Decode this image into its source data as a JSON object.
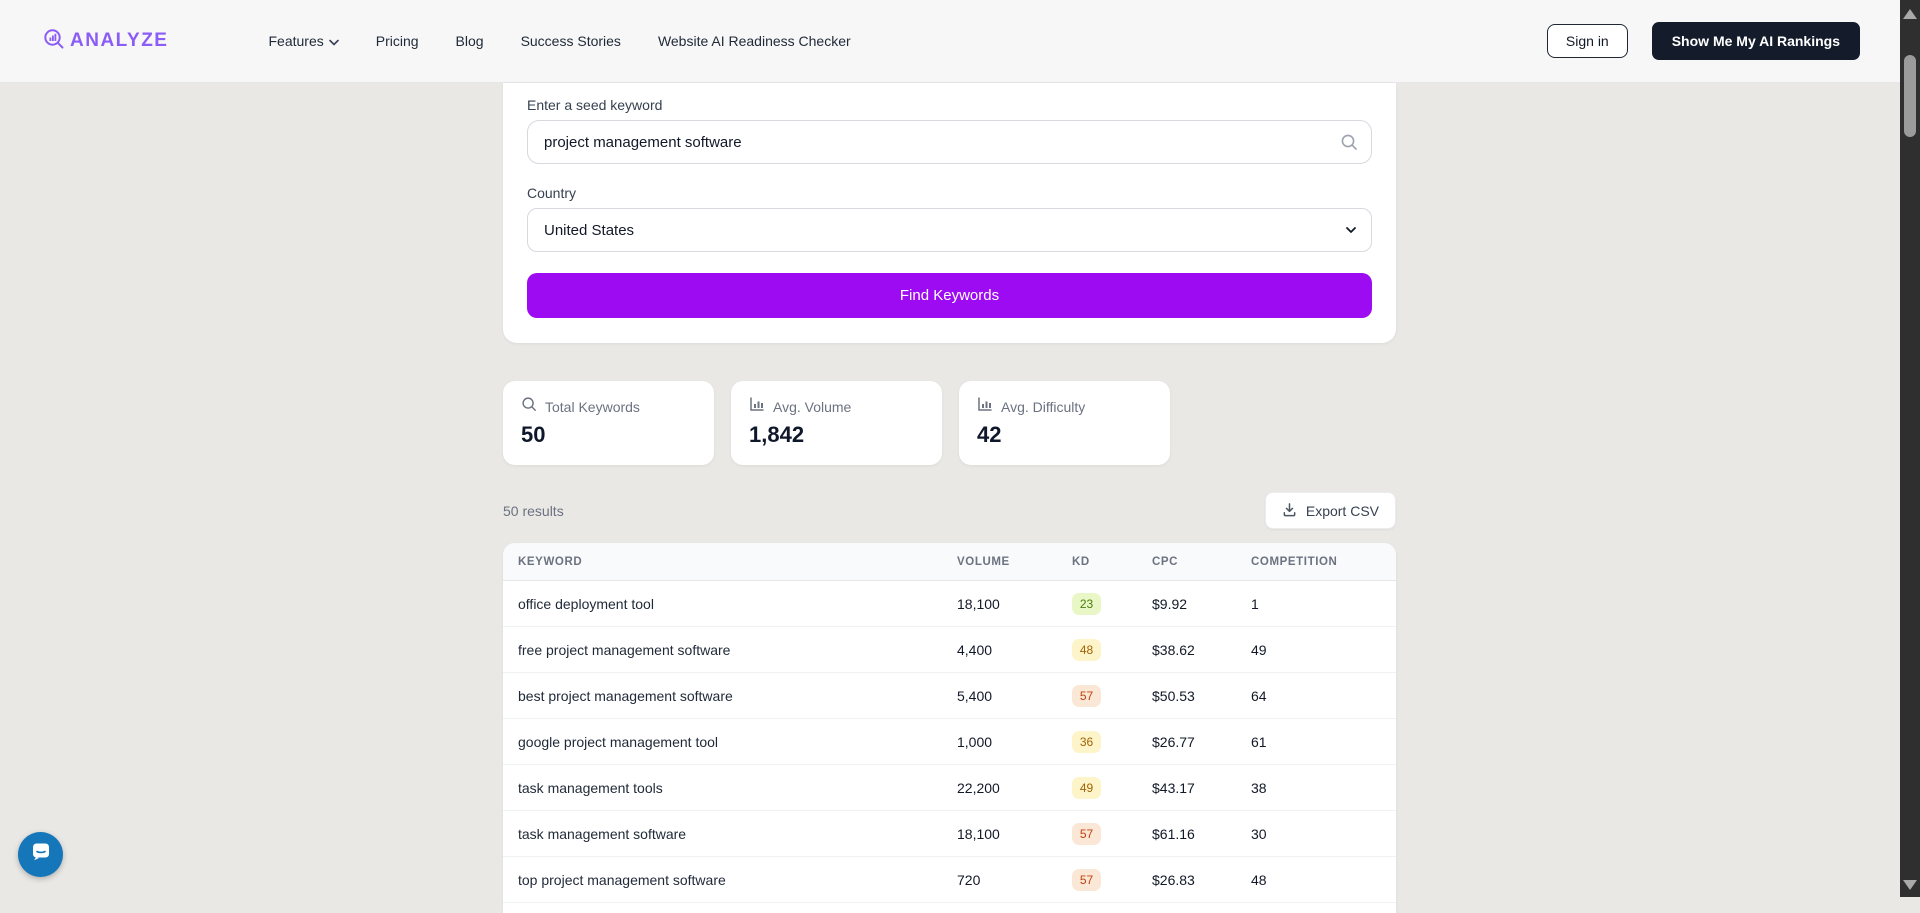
{
  "nav": {
    "logo_text": "ANALYZE",
    "links": [
      "Features",
      "Pricing",
      "Blog",
      "Success Stories",
      "Website AI Readiness Checker"
    ],
    "sign_in_label": "Sign in",
    "cta_label": "Show Me My AI Rankings"
  },
  "form": {
    "keyword_label": "Enter a seed keyword",
    "keyword_value": "project management software",
    "country_label": "Country",
    "country_value": "United States",
    "submit_label": "Find Keywords"
  },
  "stats": [
    {
      "icon": "search-icon",
      "label": "Total Keywords",
      "value": "50"
    },
    {
      "icon": "bar-chart-icon",
      "label": "Avg. Volume",
      "value": "1,842"
    },
    {
      "icon": "bar-chart-icon",
      "label": "Avg. Difficulty",
      "value": "42"
    }
  ],
  "results": {
    "count_text": "50 results",
    "export_label": "Export CSV"
  },
  "table": {
    "headers": [
      "KEYWORD",
      "VOLUME",
      "KD",
      "CPC",
      "COMPETITION"
    ],
    "rows": [
      {
        "keyword": "office deployment tool",
        "volume": "18,100",
        "kd": "23",
        "kd_level": "green",
        "cpc": "$9.92",
        "competition": "1"
      },
      {
        "keyword": "free project management software",
        "volume": "4,400",
        "kd": "48",
        "kd_level": "yellow",
        "cpc": "$38.62",
        "competition": "49"
      },
      {
        "keyword": "best project management software",
        "volume": "5,400",
        "kd": "57",
        "kd_level": "orange",
        "cpc": "$50.53",
        "competition": "64"
      },
      {
        "keyword": "google project management tool",
        "volume": "1,000",
        "kd": "36",
        "kd_level": "yellow",
        "cpc": "$26.77",
        "competition": "61"
      },
      {
        "keyword": "task management tools",
        "volume": "22,200",
        "kd": "49",
        "kd_level": "yellow",
        "cpc": "$43.17",
        "competition": "38"
      },
      {
        "keyword": "task management software",
        "volume": "18,100",
        "kd": "57",
        "kd_level": "orange",
        "cpc": "$61.16",
        "competition": "30"
      },
      {
        "keyword": "top project management software",
        "volume": "720",
        "kd": "57",
        "kd_level": "orange",
        "cpc": "$26.83",
        "competition": "48"
      }
    ]
  },
  "colors": {
    "accent_purple": "#9d0bf2",
    "logo_purple": "#8b5cf6",
    "dark_navy_button": "#141c2b",
    "badge_green_bg": "#e9f7c6",
    "badge_green_text": "#4d7c0f",
    "badge_yellow_bg": "#fdf5c9",
    "badge_yellow_text": "#a16207",
    "badge_orange_bg": "#fbe7d6",
    "badge_orange_text": "#c2410c",
    "chat_blue": "#1577b9",
    "scrollbar_track": "#2f2f2f",
    "scrollbar_thumb": "#9b9b9b"
  }
}
